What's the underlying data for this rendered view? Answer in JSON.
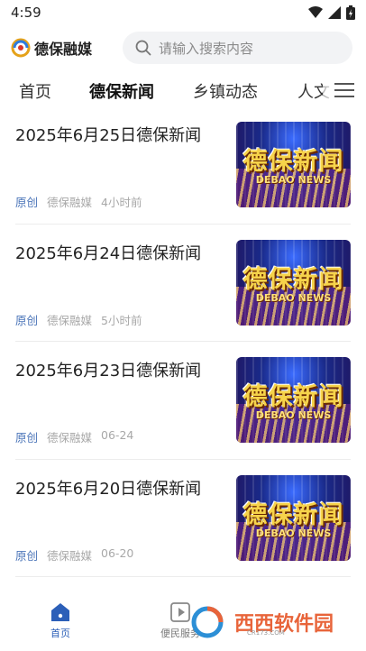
{
  "status_bar": {
    "time": "4:59"
  },
  "header": {
    "logo_text": "德保融媒",
    "search_placeholder": "请输入搜索内容"
  },
  "tabs": [
    {
      "label": "首页",
      "active": false
    },
    {
      "label": "德保新闻",
      "active": true
    },
    {
      "label": "乡镇动态",
      "active": false
    },
    {
      "label": "人文",
      "active": false
    }
  ],
  "feed": [
    {
      "title": "2025年6月25日德保新闻",
      "tag": "原创",
      "source": "德保融媒",
      "time": "4小时前"
    },
    {
      "title": "2025年6月24日德保新闻",
      "tag": "原创",
      "source": "德保融媒",
      "time": "5小时前"
    },
    {
      "title": "2025年6月23日德保新闻",
      "tag": "原创",
      "source": "德保融媒",
      "time": "06-24"
    },
    {
      "title": "2025年6月20日德保新闻",
      "tag": "原创",
      "source": "德保融媒",
      "time": "06-20"
    }
  ],
  "thumb": {
    "title": "德保新闻",
    "subtitle": "DEBAO NEWS"
  },
  "tabbar": [
    {
      "label": "首页",
      "active": true
    },
    {
      "label": "便民服务",
      "active": false
    }
  ],
  "watermark": {
    "text": "西西软件园",
    "sub": "CR173.COM"
  },
  "colors": {
    "accent": "#2c5fb8",
    "tag": "#4a74b8",
    "meta": "#a8a8a8"
  }
}
